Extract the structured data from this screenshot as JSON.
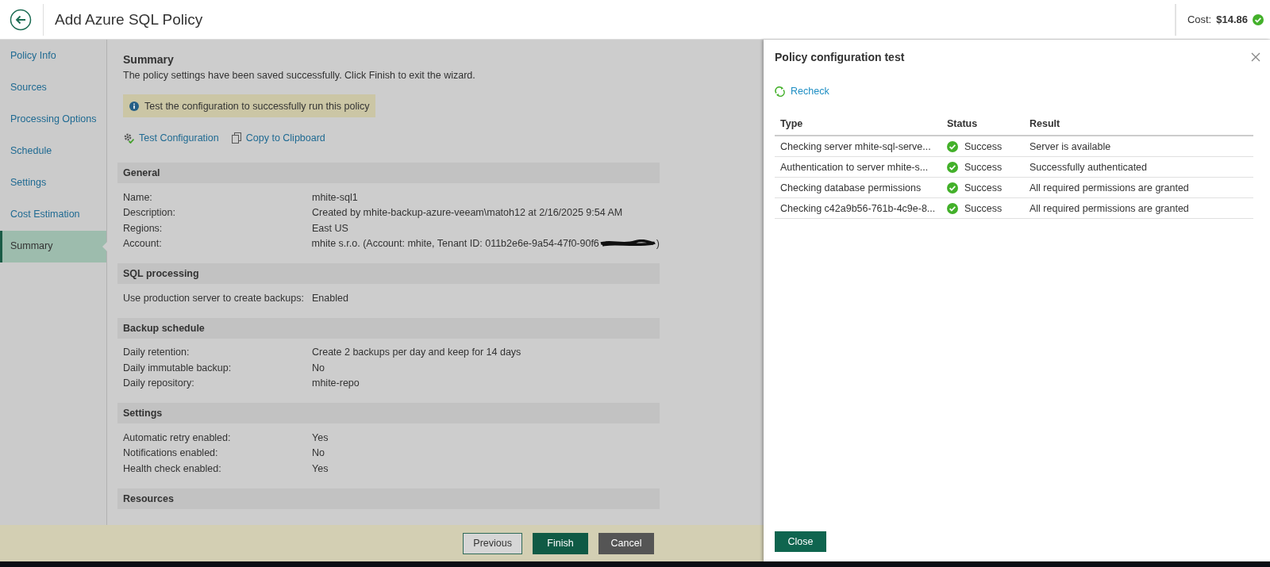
{
  "header": {
    "title": "Add Azure SQL Policy",
    "cost_label": "Cost:",
    "cost_value": "$14.86"
  },
  "nav": [
    {
      "label": "Policy Info",
      "selected": false
    },
    {
      "label": "Sources",
      "selected": false
    },
    {
      "label": "Processing Options",
      "selected": false
    },
    {
      "label": "Schedule",
      "selected": false
    },
    {
      "label": "Settings",
      "selected": false
    },
    {
      "label": "Cost Estimation",
      "selected": false
    },
    {
      "label": "Summary",
      "selected": true
    }
  ],
  "summary": {
    "title": "Summary",
    "message": "The policy settings have been saved successfully. Click Finish to exit the wizard.",
    "notice": "Test the configuration to successfully run this policy",
    "actions": [
      {
        "label": "Test Configuration",
        "kind": "test"
      },
      {
        "label": "Copy to Clipboard",
        "kind": "copy"
      }
    ],
    "sections": [
      {
        "title": "General",
        "rows": [
          {
            "label": "Name:",
            "value": "mhite-sql1",
            "kind": "text"
          },
          {
            "label": "Description:",
            "value": "Created by mhite-backup-azure-veeam\\matoh12 at 2/16/2025 9:54 AM",
            "kind": "text"
          },
          {
            "label": "Regions:",
            "value": "East US",
            "kind": "text"
          },
          {
            "label": "Account:",
            "value": "mhite s.r.o. (Account: mhite, Tenant ID: 011b2e6e-9a54-47f0-90f6",
            "value_end": ")",
            "kind": "redacted"
          }
        ]
      },
      {
        "title": "SQL processing",
        "rows": [
          {
            "label": "Use production server to create backups:",
            "value": "Enabled",
            "kind": "text"
          }
        ]
      },
      {
        "title": "Backup schedule",
        "rows": [
          {
            "label": "Daily retention:",
            "value": "Create 2 backups per day and keep for 14 days",
            "kind": "text"
          },
          {
            "label": "Daily immutable backup:",
            "value": "No",
            "kind": "text"
          },
          {
            "label": "Daily repository:",
            "value": "mhite-repo",
            "kind": "text"
          }
        ]
      },
      {
        "title": "Settings",
        "rows": [
          {
            "label": "Automatic retry enabled:",
            "value": "Yes",
            "kind": "text"
          },
          {
            "label": "Notifications enabled:",
            "value": "No",
            "kind": "text"
          },
          {
            "label": "Health check enabled:",
            "value": "Yes",
            "kind": "text"
          }
        ]
      },
      {
        "title": "Resources"
      }
    ]
  },
  "footer": {
    "buttons": [
      {
        "label": "Previous",
        "kind": "secondary"
      },
      {
        "label": "Finish",
        "kind": "primary"
      },
      {
        "label": "Cancel",
        "kind": "dark"
      }
    ]
  },
  "panel": {
    "title": "Policy configuration test",
    "recheck": "Recheck",
    "columns": [
      "Type",
      "Status",
      "Result"
    ],
    "rows": [
      {
        "type": "Checking server mhite-sql-serve...",
        "status": "Success",
        "kind": "success",
        "result": "Server is available"
      },
      {
        "type": "Authentication to server mhite-s...",
        "status": "Success",
        "kind": "success",
        "result": "Successfully authenticated"
      },
      {
        "type": "Checking database permissions",
        "status": "Success",
        "kind": "success",
        "result": "All required permissions are granted"
      },
      {
        "type": "Checking c42a9b56-761b-4c9e-8...",
        "status": "Success",
        "kind": "success",
        "result": "All required permissions are granted"
      }
    ],
    "close_button": "Close"
  }
}
